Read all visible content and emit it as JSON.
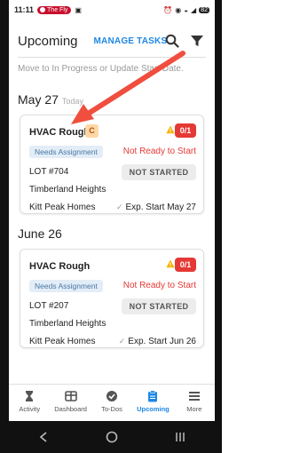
{
  "status_bar": {
    "time": "11:11",
    "app_badge": "The Fly",
    "battery": "82"
  },
  "header": {
    "title": "Upcoming",
    "manage_tasks": "MANAGE TASKS"
  },
  "hint": "Move to In Progress or Update Start Date.",
  "sections": [
    {
      "date": "May 27",
      "sub_label": "Today",
      "card": {
        "title": "HVAC Rough",
        "badge": "C",
        "count": "0/1",
        "assignment": "Needs Assignment",
        "readiness": "Not Ready to Start",
        "lot": "LOT #704",
        "status": "NOT STARTED",
        "community": "Timberland Heights",
        "builder": "Kitt Peak Homes",
        "exp_start": "Exp. Start May 27"
      }
    },
    {
      "date": "June 26",
      "card": {
        "title": "HVAC Rough",
        "count": "0/1",
        "assignment": "Needs Assignment",
        "readiness": "Not Ready to Start",
        "lot": "LOT #207",
        "status": "NOT STARTED",
        "community": "Timberland Heights",
        "builder": "Kitt Peak Homes",
        "exp_start": "Exp. Start Jun 26"
      }
    }
  ],
  "bottom_nav": [
    {
      "label": "Activity",
      "icon": "hourglass-icon"
    },
    {
      "label": "Dashboard",
      "icon": "dashboard-icon"
    },
    {
      "label": "To-Dos",
      "icon": "check-circle-icon"
    },
    {
      "label": "Upcoming",
      "icon": "clipboard-icon",
      "active": true
    },
    {
      "label": "More",
      "icon": "menu-icon"
    }
  ],
  "colors": {
    "accent": "#1e88e5",
    "alert": "#e53935",
    "warning": "#f5b301",
    "annotation_arrow": "#f04e3e"
  }
}
